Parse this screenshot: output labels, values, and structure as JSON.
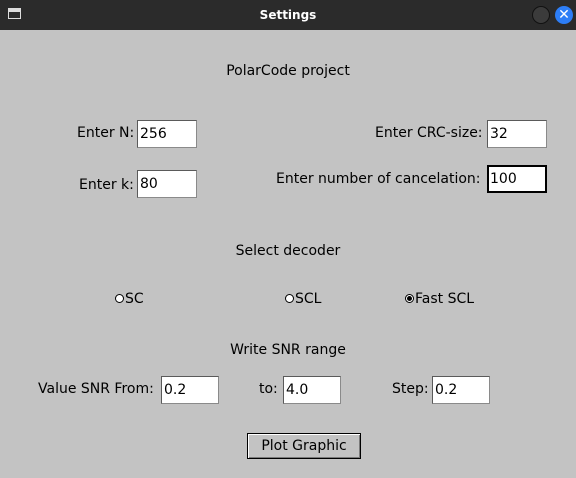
{
  "window": {
    "title": "Settings",
    "close_glyph": "✕"
  },
  "project": {
    "title": "PolarCode project"
  },
  "fields": {
    "n_label": "Enter N:",
    "n_value": "256",
    "k_label": "Enter k:",
    "k_value": "80",
    "crc_label": "Enter CRC-size:",
    "crc_value": "32",
    "cancel_label": "Enter number of cancelation:",
    "cancel_value": "100"
  },
  "decoder": {
    "heading": "Select decoder",
    "options": [
      {
        "label": "SC",
        "selected": false
      },
      {
        "label": "SCL",
        "selected": false
      },
      {
        "label": "Fast SCL",
        "selected": true
      }
    ]
  },
  "snr": {
    "heading": "Write SNR range",
    "from_label": "Value SNR From:",
    "from_value": "0.2",
    "to_label": "to:",
    "to_value": "4.0",
    "step_label": "Step:",
    "step_value": "0.2"
  },
  "plot_button": {
    "label": "Plot Graphic"
  }
}
